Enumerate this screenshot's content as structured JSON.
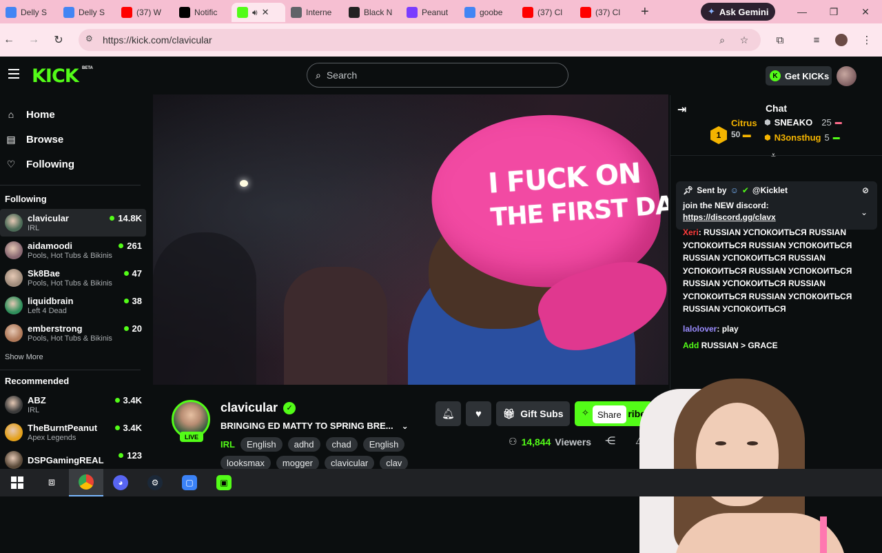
{
  "browser": {
    "tabs": [
      {
        "title": "Delly S",
        "icon": "google-drive-icon",
        "color": "#4285f4"
      },
      {
        "title": "Delly S",
        "icon": "google-drive-icon",
        "color": "#4285f4"
      },
      {
        "title": "(37) W",
        "icon": "youtube-icon",
        "color": "#ff0000"
      },
      {
        "title": "Notific",
        "icon": "x-icon",
        "color": "#000000"
      },
      {
        "title": "",
        "icon": "kick-icon",
        "color": "#53fc18",
        "active": true
      },
      {
        "title": "Interne",
        "icon": "globe-icon",
        "color": "#5f6368"
      },
      {
        "title": "Black N",
        "icon": "wix-icon",
        "color": "#222222"
      },
      {
        "title": "Peanut",
        "icon": "media-icon",
        "color": "#7a3cff"
      },
      {
        "title": "goobe",
        "icon": "google-icon",
        "color": "#4285f4"
      },
      {
        "title": "(37) Cl",
        "icon": "youtube-icon",
        "color": "#ff0000"
      },
      {
        "title": "(37) Cl",
        "icon": "youtube-icon",
        "color": "#ff0000"
      }
    ],
    "gemini_label": "Ask Gemini",
    "url": "https://kick.com/clavicular"
  },
  "header": {
    "logo": "KICK",
    "logo_badge": "BETA",
    "search_placeholder": "Search",
    "get_kicks_label": "Get KICKs"
  },
  "sidebar": {
    "nav": [
      {
        "label": "Home",
        "icon": "home-icon"
      },
      {
        "label": "Browse",
        "icon": "browse-icon"
      },
      {
        "label": "Following",
        "icon": "heart-icon"
      }
    ],
    "following_title": "Following",
    "following": [
      {
        "name": "clavicular",
        "category": "IRL",
        "viewers": "14.8K",
        "color": "#4c6b57",
        "selected": true
      },
      {
        "name": "aidamoodi",
        "category": "Pools, Hot Tubs & Bikinis",
        "viewers": "261",
        "color": "#8a6a73"
      },
      {
        "name": "Sk8Bae",
        "category": "Pools, Hot Tubs & Bikinis",
        "viewers": "47",
        "color": "#a08c7c"
      },
      {
        "name": "liquidbrain",
        "category": "Left 4 Dead",
        "viewers": "38",
        "color": "#2f8f5b"
      },
      {
        "name": "emberstrong",
        "category": "Pools, Hot Tubs & Bikinis",
        "viewers": "20",
        "color": "#b07a5a"
      }
    ],
    "show_more": "Show More",
    "recommended_title": "Recommended",
    "recommended": [
      {
        "name": "ABZ",
        "category": "IRL",
        "viewers": "3.4K",
        "color": "#3b3b3b"
      },
      {
        "name": "TheBurntPeanut",
        "category": "Apex Legends",
        "viewers": "3.4K",
        "color": "#e4a11b"
      },
      {
        "name": "DSPGamingREAL",
        "category": "",
        "viewers": "123",
        "color": "#5a4a3a"
      }
    ]
  },
  "video": {
    "cap_line1": "I FUCK ON",
    "cap_line2": "THE FIRST DATE"
  },
  "stream": {
    "streamer": "clavicular",
    "live_label": "LIVE",
    "title": "BRINGING ED MATTY TO SPRING BRE...",
    "category": "IRL",
    "tags_row1": [
      "English",
      "adhd",
      "chad",
      "English"
    ],
    "tags_row2": [
      "looksmax",
      "mogger",
      "clavicular",
      "clav"
    ],
    "gift_subs_label": "Gift Subs",
    "subscribe_visible": "ribe",
    "tooltip": "Share",
    "viewers_count": "14,844",
    "viewers_label": "Viewers"
  },
  "chat": {
    "title": "Chat",
    "leaderboard": [
      {
        "name": "Citrus",
        "value": "50",
        "color": "#f4b400"
      },
      {
        "name": "SNEAKO",
        "value": "25",
        "color": "#ff6b8b"
      },
      {
        "name": "N3onsthug",
        "value": "5",
        "color": "#53fc18"
      }
    ],
    "pinned_sender_prefix": "Sent by",
    "pinned_sender": "@Kicklet",
    "pinned_text": "join the NEW discord:",
    "pinned_link": "https://discord.gg/clavx",
    "messages": [
      {
        "user": "Xeri",
        "text": ": RUSSIAN УСПОКОИТЬСЯ RUSSIAN УСПОКОИТЬСЯ RUSSIAN УСПОКОИТЬСЯ RUSSIAN УСПОКОИТЬСЯ RUSSIAN УСПОКОИТЬСЯ RUSSIAN УСПОКОИТЬСЯ RUSSIAN УСПОКОИТЬСЯ RUSSIAN УСПОКОИТЬСЯ RUSSIAN УСПОКОИТЬСЯ RUSSIAN УСПОКОИТЬСЯ"
      },
      {
        "user": "lalolover",
        "text": ": play"
      },
      {
        "user": "Add",
        "text": " RUSSIAN > GRACE"
      }
    ]
  }
}
